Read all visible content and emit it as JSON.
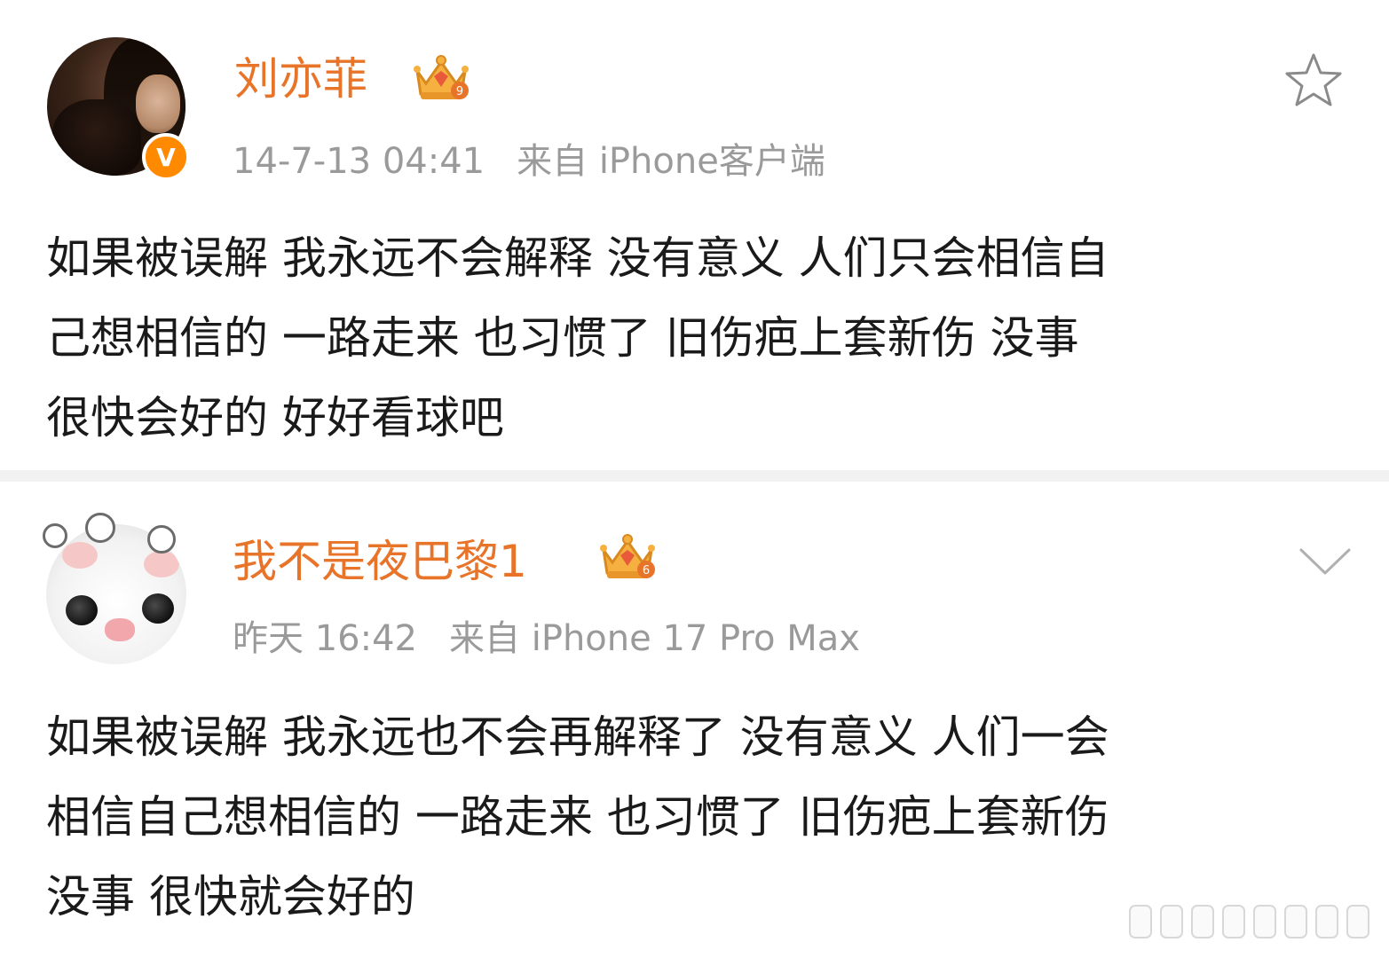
{
  "posts": [
    {
      "username": "刘亦菲",
      "timestamp": "14-7-13 04:41",
      "source": "来自 iPhone客户端",
      "body_lines": [
        "如果被误解 我永远不会解释 没有意义 人们只会相信自",
        "己想相信的 一路走来 也习惯了 旧伤疤上套新伤 没事",
        "很快会好的 好好看球吧"
      ],
      "badge_level": "9",
      "action_icon": "star-icon"
    },
    {
      "username": "我不是夜巴黎1",
      "timestamp": "昨天 16:42",
      "source": "来自 iPhone 17 Pro Max",
      "body_lines": [
        "如果被误解 我永远也不会再解释了  没有意义 人们一会",
        "相信自己想相信的 一路走来 也习惯了 旧伤疤上套新伤",
        "没事 很快就会好的"
      ],
      "badge_level": "6",
      "action_icon": "chevron-down-icon"
    }
  ],
  "colors": {
    "username": "#e8742a",
    "meta": "#9a9a9a",
    "body": "#1a1a1a",
    "verified": "#ff8a00",
    "crown": "#f0a030",
    "divider": "#f2f2f2"
  }
}
